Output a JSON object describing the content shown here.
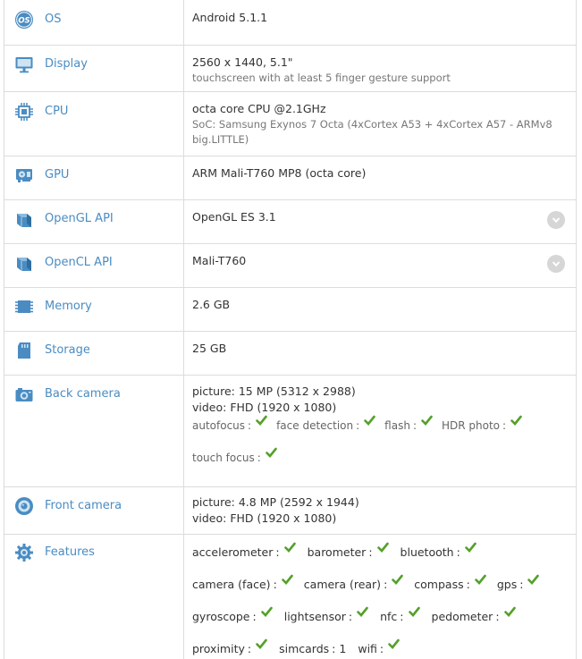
{
  "rows": {
    "os": {
      "label": "OS",
      "icon": "os-icon",
      "main": "Android 5.1.1"
    },
    "display": {
      "label": "Display",
      "icon": "monitor-icon",
      "main": "2560 x 1440, 5.1\"",
      "sub": "touchscreen with at least 5 finger gesture support"
    },
    "cpu": {
      "label": "CPU",
      "icon": "cpu-chip-icon",
      "main": "octa core CPU @2.1GHz",
      "sub": "SoC: Samsung Exynos 7 Octa (4xCortex A53 + 4xCortex A57 - ARMv8 big.LITTLE)"
    },
    "gpu": {
      "label": "GPU",
      "icon": "gpu-card-icon",
      "main": "ARM Mali-T760 MP8 (octa core)"
    },
    "opengl": {
      "label": "OpenGL API",
      "icon": "cube-icon",
      "main": "OpenGL ES 3.1"
    },
    "opencl": {
      "label": "OpenCL API",
      "icon": "cube-icon",
      "main": "Mali-T760"
    },
    "memory": {
      "label": "Memory",
      "icon": "memory-chip-icon",
      "main": "2.6 GB"
    },
    "storage": {
      "label": "Storage",
      "icon": "sd-card-icon",
      "main": "25 GB"
    },
    "back_camera": {
      "label": "Back camera",
      "icon": "camera-icon",
      "picture": "picture: 15 MP (5312 x 2988)",
      "video": "video: FHD (1920 x 1080)",
      "features": [
        "autofocus",
        "face detection",
        "flash",
        "HDR photo"
      ],
      "features2": [
        "touch focus"
      ]
    },
    "front_camera": {
      "label": "Front camera",
      "icon": "front-camera-icon",
      "picture": "picture: 4.8 MP (2592 x 1944)",
      "video": "video: FHD (1920 x 1080)"
    },
    "features": {
      "label": "Features",
      "icon": "gear-icon",
      "line1": [
        "accelerometer",
        "barometer",
        "bluetooth"
      ],
      "line2": [
        "camera (face)",
        "camera (rear)",
        "compass",
        "gps"
      ],
      "line3": [
        "gyroscope",
        "lightsensor",
        "nfc",
        "pedometer"
      ],
      "line4_a": "proximity",
      "simcards_label": "simcards",
      "simcards_value": "1",
      "line4_c": "wifi"
    }
  },
  "colors": {
    "label": "#4a8cc2",
    "check": "#55a02b",
    "border": "#dcdcdc",
    "icon": "#4a8cc2"
  }
}
